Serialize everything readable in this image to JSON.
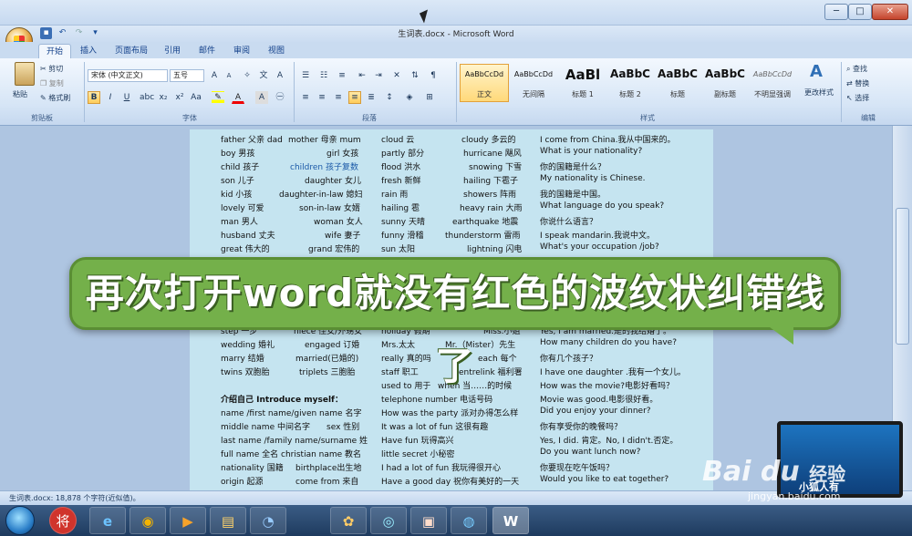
{
  "window": {
    "title": "生词表.docx - Microsoft Word",
    "controls": [
      "─",
      "□",
      "✕"
    ]
  },
  "quick_access": [
    "save-icon",
    "undo-icon",
    "redo-icon",
    "customize-icon"
  ],
  "ribbon_tabs": [
    "开始",
    "插入",
    "页面布局",
    "引用",
    "邮件",
    "审阅",
    "视图"
  ],
  "clipboard": {
    "paste": "粘贴",
    "cut": "剪切",
    "copy": "复制",
    "format_painter": "格式刷",
    "label": "剪贴板"
  },
  "font": {
    "family": "宋体 (中文正文)",
    "size": "五号",
    "label": "字体"
  },
  "paragraph": {
    "label": "段落"
  },
  "styles": {
    "label": "样式",
    "tiles": [
      {
        "sample": "AaBbCcDd",
        "name": "正文"
      },
      {
        "sample": "AaBbCcDd",
        "name": "无间隔"
      },
      {
        "sample": "AaBl",
        "name": "标题 1"
      },
      {
        "sample": "AaBbC",
        "name": "标题 2"
      },
      {
        "sample": "AaBbC",
        "name": "标题"
      },
      {
        "sample": "AaBbC",
        "name": "副标题"
      },
      {
        "sample": "AaBbCcDd",
        "name": "不明显强调"
      }
    ],
    "change_styles": "更改样式"
  },
  "editing": {
    "find": "查找",
    "replace": "替换",
    "select": "选择",
    "label": "编辑"
  },
  "document": {
    "col1": [
      "father 父亲 dad",
      "boy 男孩",
      "child 孩子",
      "son 儿子",
      "kid 小孩",
      "lovely 可爱",
      "man 男人",
      "husband 丈夫",
      "great 伟大的"
    ],
    "col2": [
      "mother 母亲 mum",
      "girl 女孩",
      "children 孩子复数",
      "daughter 女儿",
      "daughter-in-law 媳妇",
      "son-in-law 女婿",
      "woman 女人",
      "wife 妻子",
      "grand 宏伟的"
    ],
    "col3": [
      "cloudy 多云的",
      "hurricane 飓风",
      "snowing 下雪",
      "hailing 下雹子",
      "showers 阵雨",
      "heavy rain 大雨",
      "earthquake 地震",
      "thunderstorm 雷雨",
      "lightning 闪电"
    ],
    "col_weather": [
      "cloud 云",
      "partly 部分",
      "flood 洪水",
      "fresh 新鲜",
      "rain 雨",
      "hailing 雹",
      "sunny 天晴",
      "funny 滑稽",
      "sun 太阳"
    ],
    "col4": [
      "I come from China.我从中国来的。",
      "What is your nationality?",
      "你的国籍是什么？",
      "My nationality is Chinese.",
      "我的国籍是中国。",
      "What language do you speak?",
      "你说什么语言？",
      "I speak mandarin.我说中文。",
      "What's your occupation /job?"
    ],
    "lower_left": [
      "step 一步",
      "wedding 婚礼",
      "marry 结婚",
      "twins 双胞胎",
      "介绍自己 Introduce myself：",
      "name /first name/given name 名字",
      "middle name 中间名字",
      "last name /family name/surname 姓",
      "full name 全名",
      "nationality 国籍",
      "origin 起源"
    ],
    "lower_mid": [
      "niece 侄女/外甥女",
      "engaged 订婚",
      "married(已婚的)",
      "triplets 三胞胎",
      "",
      "",
      "sex 性别",
      "",
      "christian name 教名",
      "birthplace出生地",
      "come from 来自"
    ],
    "lower_col3": [
      "holiday 假期",
      "Mrs.太太",
      "really 真的吗",
      "staff 职工",
      "used to 用于",
      "telephone number 电话号码",
      "How was the party 派对办得怎么样",
      "It was a lot of fun 这很有趣",
      "Have fun 玩得高兴",
      "little secret 小秘密",
      "I had a lot of fun 我玩得很开心",
      "Have a good day 祝你有美好的一天"
    ],
    "lower_col3b": [
      "Miss.小姐",
      "Mr.（Mister）先生",
      "each 每个",
      "centrelink 福利署",
      "when 当……的时候"
    ],
    "lower_col4": [
      "Yes, I am married.是的我结婚了。",
      "How many children do you have?",
      "你有几个孩子？",
      "I have one daughter .我有一个女儿。",
      "How was the movie?电影好看吗？",
      "Movie was good.电影很好看。",
      "Did you enjoy your dinner?",
      "你有享受你的晚餐吗？",
      "Yes, I did. 肯定。No, I didn't.否定。",
      "Do you want lunch now?",
      "你要现在吃午饭吗？",
      "Would you like to eat together?"
    ]
  },
  "overlay_text": "再次打开word就没有红色的波纹状纠错线了",
  "status": "生词表.docx: 18,878 个字符(近似值)。",
  "taskbar_apps": [
    "将",
    "e",
    "◉",
    "▶",
    "▤",
    "◔",
    "✿",
    "◎",
    "▣",
    "◍",
    "W"
  ],
  "watermark": "Bai du",
  "watermark_tag": "经验",
  "watermark_url": "jingyan.baidu.com",
  "thumb_caption": "小狐人有"
}
